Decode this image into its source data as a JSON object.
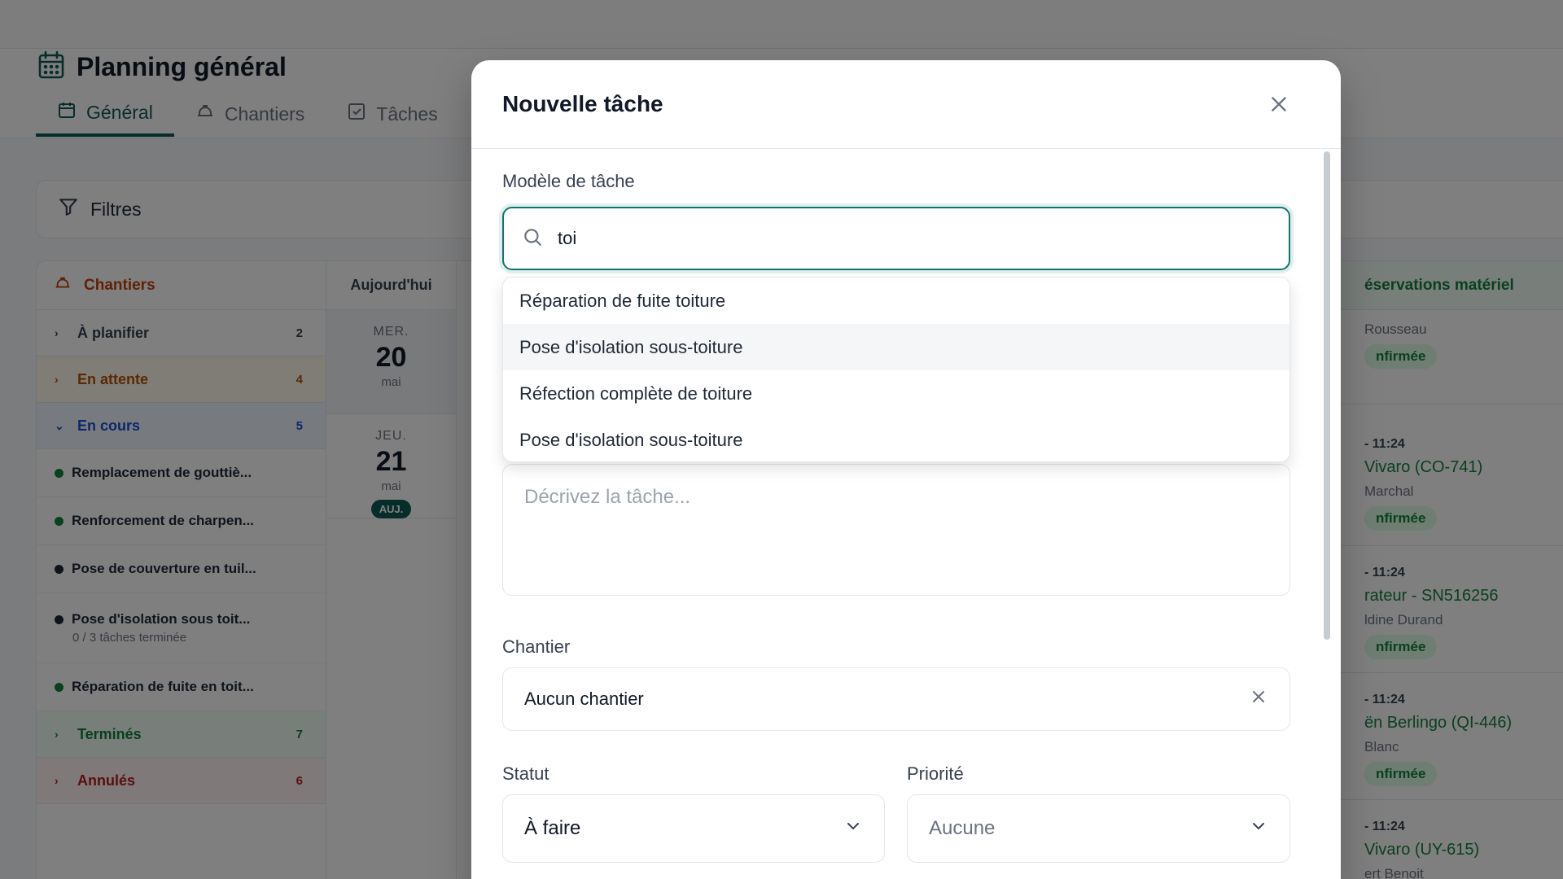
{
  "page": {
    "title": "Planning général",
    "tabs": [
      {
        "label": "Général"
      },
      {
        "label": "Chantiers"
      },
      {
        "label": "Tâches"
      }
    ],
    "filters_label": "Filtres"
  },
  "sidebar": {
    "header": "Chantiers",
    "groups": [
      {
        "label": "À planifier",
        "count": "2"
      },
      {
        "label": "En attente",
        "count": "4"
      },
      {
        "label": "En cours",
        "count": "5"
      },
      {
        "label": "Terminés",
        "count": "7"
      },
      {
        "label": "Annulés",
        "count": "6"
      }
    ],
    "items": [
      {
        "label": "Remplacement de gouttiè..."
      },
      {
        "label": "Renforcement de charpen..."
      },
      {
        "label": "Pose de couverture en tuil..."
      },
      {
        "label": "Pose d'isolation sous toit...",
        "sub": "0 / 3 tâches terminée"
      },
      {
        "label": "Réparation de fuite en toit..."
      }
    ]
  },
  "calendar": {
    "header": "Aujourd'hui",
    "days": [
      {
        "name": "MER.",
        "num": "20",
        "month": "mai"
      },
      {
        "name": "JEU.",
        "num": "21",
        "month": "mai",
        "badge": "AUJ."
      }
    ]
  },
  "reservations": {
    "header": "éservations matériel",
    "cards": [
      {
        "time": "",
        "vehicle": "",
        "person": "Rousseau",
        "status": "nfirmée"
      },
      {
        "time": "- 11:24",
        "vehicle": "Vivaro (CO-741)",
        "person": "Marchal",
        "status": "nfirmée"
      },
      {
        "time": "- 11:24",
        "vehicle": "rateur - SN516256",
        "person": "ldine Durand",
        "status": "nfirmée"
      },
      {
        "time": "- 11:24",
        "vehicle": "ën Berlingo (QI-446)",
        "person": "Blanc",
        "status": "nfirmée"
      },
      {
        "time": "- 11:24",
        "vehicle": "Vivaro (UY-615)",
        "person": "ert Benoit",
        "status": ""
      }
    ]
  },
  "modal": {
    "title": "Nouvelle tâche",
    "template_label": "Modèle de tâche",
    "search_value": "toi",
    "suggestions": [
      {
        "label": "Réparation de fuite toiture"
      },
      {
        "label": "Pose d'isolation sous-toiture"
      },
      {
        "label": "Réfection complète de toiture"
      },
      {
        "label": "Pose d'isolation sous-toiture"
      }
    ],
    "description_placeholder": "Décrivez la tâche...",
    "chantier_label": "Chantier",
    "chantier_value": "Aucun chantier",
    "statut_label": "Statut",
    "statut_value": "À faire",
    "priorite_label": "Priorité",
    "priorite_value": "Aucune"
  },
  "colors": {
    "accent": "#0f5b57",
    "overlay": "rgba(0,0,0,0.5)"
  }
}
